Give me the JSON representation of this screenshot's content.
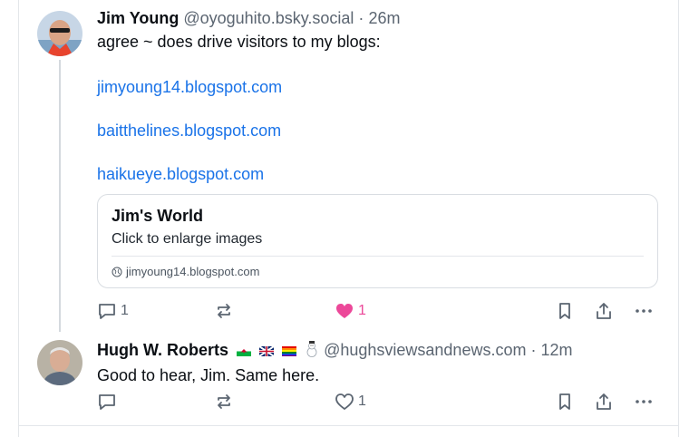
{
  "post1": {
    "author_name": "Jim Young",
    "handle": "@oyoguhito.bsky.social",
    "separator": "·",
    "time": "26m",
    "text": "agree ~ does drive visitors to my blogs:",
    "links": [
      "jimyoung14.blogspot.com",
      "baitthelines.blogspot.com",
      "haikueye.blogspot.com"
    ],
    "card": {
      "title": "Jim's World",
      "description": "Click to enlarge images",
      "domain": "jimyoung14.blogspot.com"
    },
    "actions": {
      "reply_count": "1",
      "repost_count": "",
      "like_count": "1",
      "liked": true
    }
  },
  "post2": {
    "author_name": "Hugh W. Roberts",
    "handle": "@hughsviewsandnews.com",
    "separator": "·",
    "time": "12m",
    "badges": [
      "wales-flag",
      "uk-flag",
      "rainbow-flag",
      "snowman"
    ],
    "text": "Good to hear, Jim. Same here.",
    "actions": {
      "reply_count": "",
      "repost_count": "",
      "like_count": "1",
      "liked": false
    }
  },
  "colors": {
    "link": "#1a73e8",
    "like_active": "#ec4899",
    "muted": "#5b6571"
  },
  "icons": [
    "reply-icon",
    "repost-icon",
    "like-icon",
    "bookmark-icon",
    "share-icon",
    "more-icon",
    "globe-icon"
  ]
}
